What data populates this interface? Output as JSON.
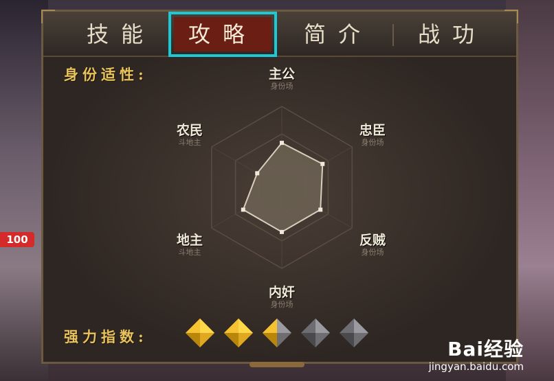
{
  "tabs": [
    {
      "label": "技能",
      "active": false
    },
    {
      "label": "攻略",
      "active": true
    },
    {
      "label": "简介",
      "active": false
    },
    {
      "label": "战功",
      "active": false
    }
  ],
  "labels": {
    "identity_suitability": "身份适性:",
    "power_index": "强力指数:"
  },
  "side_badge": "100",
  "radar": {
    "axes": [
      {
        "name": "主公",
        "sub": "身份场",
        "value": 0.55
      },
      {
        "name": "忠臣",
        "sub": "身份场",
        "value": 0.58
      },
      {
        "name": "反贼",
        "sub": "身份场",
        "value": 0.55
      },
      {
        "name": "内奸",
        "sub": "身份场",
        "value": 0.55
      },
      {
        "name": "地主",
        "sub": "斗地主",
        "value": 0.55
      },
      {
        "name": "农民",
        "sub": "斗地主",
        "value": 0.35
      }
    ]
  },
  "power_rating": {
    "value": 2.5,
    "max": 5
  },
  "colors": {
    "gold": "#e8c25a",
    "active_tab": "#6b1e14",
    "highlight": "#1ec9d6"
  },
  "watermark": {
    "brand": "Bai经验",
    "url": "jingyan.baidu.com"
  }
}
